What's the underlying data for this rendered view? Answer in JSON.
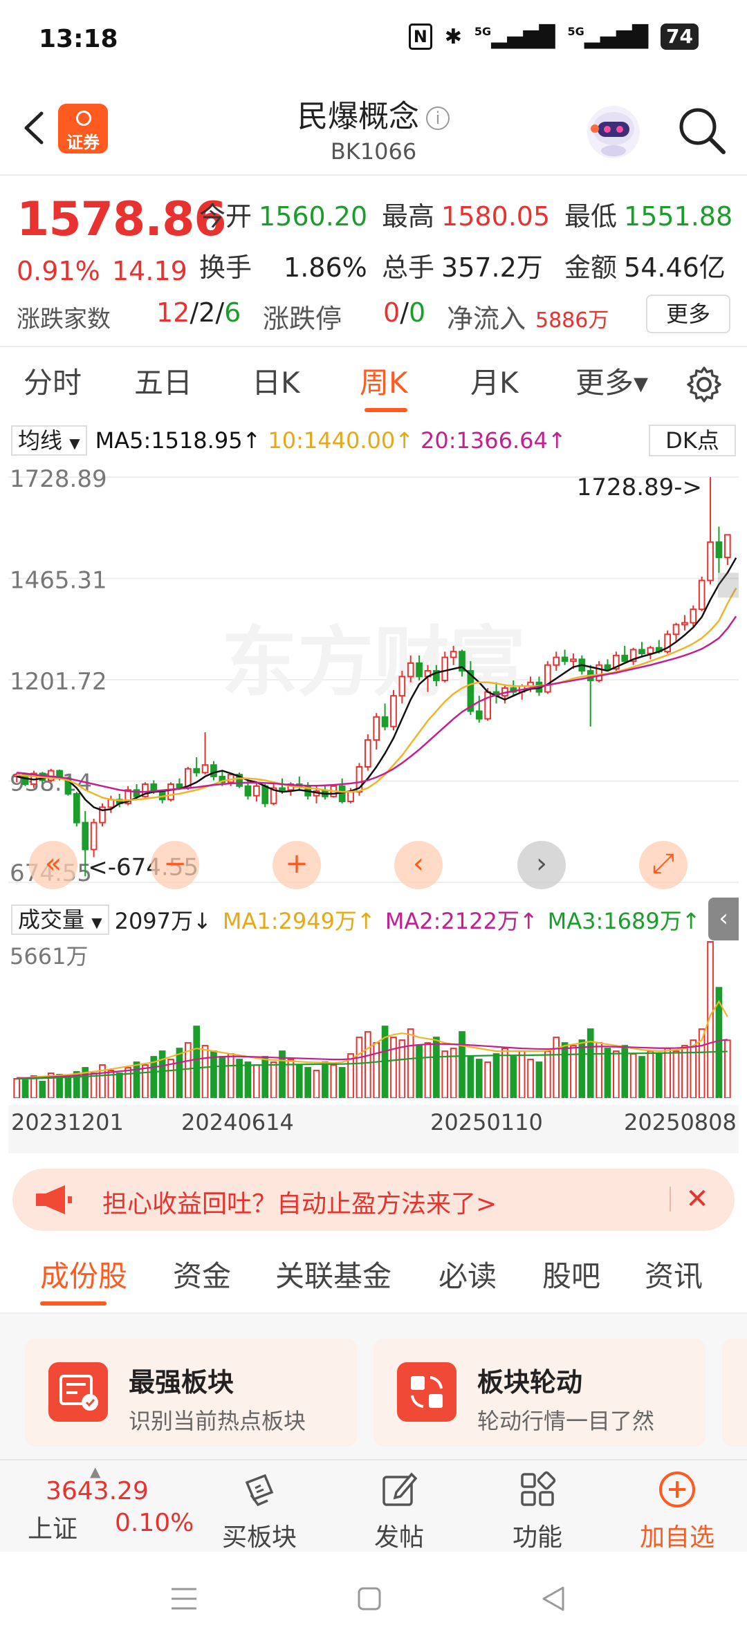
{
  "status_bar": {
    "time": "13:18",
    "signal1": "5G",
    "signal2": "5G",
    "battery": "74"
  },
  "header": {
    "title": "民爆概念",
    "code": "BK1066",
    "broker_logo_text": "证券",
    "info_icon": "i"
  },
  "quote": {
    "price": "1578.86",
    "pct": "0.91%",
    "change": "14.19",
    "open_label": "今开",
    "open": "1560.20",
    "high_label": "最高",
    "high": "1580.05",
    "low_label": "最低",
    "low": "1551.88",
    "turnover_label": "换手",
    "turnover": "1.86%",
    "volume_label": "总手",
    "volume": "357.2万",
    "amount_label": "金额",
    "amount": "54.46亿",
    "breadth_label": "涨跌家数",
    "breadth_up": "12",
    "breadth_flat": "2",
    "breadth_down": "6",
    "sep": "/",
    "limit_label": "涨跌停",
    "limit_up": "0",
    "limit_down": "0",
    "netflow_label": "净流入",
    "netflow": "5886万",
    "more_button": "更多"
  },
  "period_tabs": [
    {
      "label": "分时"
    },
    {
      "label": "五日"
    },
    {
      "label": "日K"
    },
    {
      "label": "周K"
    },
    {
      "label": "月K"
    },
    {
      "label": "更多▾"
    }
  ],
  "active_period": "周K",
  "ma_bar": {
    "select": "均线",
    "ma5": "MA5:1518.95↑",
    "ma10": "10:1440.00↑",
    "ma20": "20:1366.64↑",
    "dk_button": "DK点"
  },
  "colors": {
    "up": "#e8322f",
    "down": "#1a9d2a",
    "ma5": "#111111",
    "ma10": "#f0b429",
    "ma20": "#c41f8f",
    "accent": "#ff5a1f"
  },
  "chart_data": {
    "type": "candlestick",
    "y_ticks": [
      "1728.89",
      "1465.31",
      "1201.72",
      "938.14",
      "674.55"
    ],
    "ylim": [
      674.55,
      1728.89
    ],
    "max_marker": "1728.89->",
    "min_marker": "<-674.55",
    "x_ticks": [
      "20231201",
      "20240614",
      "20250110",
      "20250808"
    ],
    "watermark": "东方财富",
    "candles": [
      [
        950,
        960,
        935,
        955
      ],
      [
        955,
        958,
        925,
        930
      ],
      [
        930,
        965,
        920,
        958
      ],
      [
        958,
        962,
        930,
        940
      ],
      [
        940,
        970,
        935,
        965
      ],
      [
        965,
        968,
        940,
        945
      ],
      [
        945,
        950,
        900,
        905
      ],
      [
        905,
        910,
        820,
        830
      ],
      [
        830,
        860,
        690,
        760
      ],
      [
        760,
        840,
        740,
        830
      ],
      [
        830,
        880,
        820,
        870
      ],
      [
        870,
        900,
        855,
        890
      ],
      [
        890,
        905,
        870,
        880
      ],
      [
        880,
        925,
        875,
        915
      ],
      [
        915,
        930,
        890,
        898
      ],
      [
        898,
        935,
        895,
        930
      ],
      [
        930,
        940,
        905,
        910
      ],
      [
        910,
        915,
        880,
        890
      ],
      [
        890,
        935,
        885,
        930
      ],
      [
        930,
        945,
        915,
        920
      ],
      [
        920,
        975,
        915,
        970
      ],
      [
        970,
        1000,
        950,
        960
      ],
      [
        960,
        1065,
        955,
        980
      ],
      [
        980,
        990,
        940,
        950
      ],
      [
        950,
        965,
        925,
        935
      ],
      [
        935,
        960,
        925,
        955
      ],
      [
        955,
        960,
        920,
        925
      ],
      [
        925,
        940,
        890,
        900
      ],
      [
        900,
        935,
        885,
        925
      ],
      [
        925,
        930,
        870,
        880
      ],
      [
        880,
        930,
        875,
        920
      ],
      [
        920,
        945,
        905,
        915
      ],
      [
        915,
        935,
        900,
        930
      ],
      [
        930,
        950,
        915,
        925
      ],
      [
        925,
        935,
        890,
        900
      ],
      [
        900,
        925,
        880,
        912
      ],
      [
        912,
        928,
        890,
        898
      ],
      [
        898,
        930,
        895,
        925
      ],
      [
        925,
        945,
        880,
        885
      ],
      [
        885,
        920,
        880,
        910
      ],
      [
        910,
        985,
        900,
        975
      ],
      [
        975,
        1060,
        965,
        1045
      ],
      [
        1045,
        1115,
        1020,
        1105
      ],
      [
        1105,
        1140,
        1070,
        1080
      ],
      [
        1080,
        1175,
        1070,
        1160
      ],
      [
        1160,
        1225,
        1140,
        1210
      ],
      [
        1210,
        1265,
        1195,
        1245
      ],
      [
        1245,
        1265,
        1200,
        1210
      ],
      [
        1210,
        1240,
        1170,
        1225
      ],
      [
        1225,
        1240,
        1185,
        1200
      ],
      [
        1200,
        1275,
        1195,
        1260
      ],
      [
        1260,
        1290,
        1240,
        1275
      ],
      [
        1275,
        1280,
        1210,
        1225
      ],
      [
        1225,
        1250,
        1110,
        1120
      ],
      [
        1120,
        1160,
        1090,
        1100
      ],
      [
        1100,
        1180,
        1095,
        1170
      ],
      [
        1170,
        1195,
        1140,
        1160
      ],
      [
        1160,
        1190,
        1140,
        1180
      ],
      [
        1180,
        1200,
        1160,
        1170
      ],
      [
        1170,
        1190,
        1150,
        1185
      ],
      [
        1185,
        1210,
        1170,
        1195
      ],
      [
        1195,
        1210,
        1160,
        1170
      ],
      [
        1170,
        1250,
        1165,
        1240
      ],
      [
        1240,
        1275,
        1225,
        1260
      ],
      [
        1260,
        1280,
        1240,
        1250
      ],
      [
        1250,
        1270,
        1230,
        1255
      ],
      [
        1255,
        1265,
        1215,
        1225
      ],
      [
        1225,
        1240,
        1080,
        1200
      ],
      [
        1200,
        1250,
        1195,
        1240
      ],
      [
        1240,
        1255,
        1225,
        1230
      ],
      [
        1230,
        1275,
        1225,
        1265
      ],
      [
        1265,
        1290,
        1245,
        1250
      ],
      [
        1250,
        1285,
        1240,
        1280
      ],
      [
        1280,
        1300,
        1260,
        1270
      ],
      [
        1270,
        1290,
        1255,
        1285
      ],
      [
        1285,
        1305,
        1270,
        1275
      ],
      [
        1275,
        1330,
        1270,
        1320
      ],
      [
        1320,
        1350,
        1300,
        1345
      ],
      [
        1345,
        1370,
        1330,
        1350
      ],
      [
        1350,
        1395,
        1340,
        1385
      ],
      [
        1385,
        1470,
        1380,
        1460
      ],
      [
        1460,
        1728.89,
        1450,
        1560
      ],
      [
        1560,
        1600,
        1480,
        1520
      ],
      [
        1520,
        1580,
        1500,
        1578.86
      ]
    ],
    "ma5": [
      950,
      945,
      942,
      945,
      950,
      948,
      940,
      920,
      890,
      870,
      862,
      865,
      880,
      885,
      895,
      905,
      910,
      912,
      915,
      918,
      925,
      935,
      950,
      960,
      965,
      958,
      950,
      940,
      935,
      925,
      915,
      910,
      912,
      915,
      912,
      908,
      905,
      905,
      908,
      912,
      920,
      945,
      975,
      1010,
      1050,
      1100,
      1150,
      1190,
      1210,
      1220,
      1225,
      1230,
      1235,
      1215,
      1195,
      1170,
      1160,
      1150,
      1160,
      1170,
      1178,
      1180,
      1190,
      1205,
      1220,
      1235,
      1240,
      1235,
      1230,
      1225,
      1235,
      1245,
      1255,
      1262,
      1268,
      1275,
      1285,
      1300,
      1318,
      1338,
      1365,
      1410,
      1450,
      1480,
      1518.95
    ],
    "ma10": [
      955,
      952,
      950,
      948,
      946,
      945,
      940,
      930,
      915,
      905,
      895,
      890,
      888,
      888,
      890,
      892,
      895,
      898,
      902,
      905,
      910,
      915,
      922,
      930,
      938,
      942,
      945,
      945,
      943,
      940,
      935,
      930,
      925,
      922,
      920,
      918,
      915,
      912,
      910,
      910,
      912,
      920,
      935,
      955,
      980,
      1005,
      1035,
      1065,
      1095,
      1120,
      1145,
      1165,
      1180,
      1190,
      1195,
      1195,
      1192,
      1188,
      1185,
      1185,
      1185,
      1186,
      1188,
      1192,
      1198,
      1205,
      1210,
      1213,
      1215,
      1218,
      1222,
      1228,
      1235,
      1242,
      1250,
      1258,
      1266,
      1275,
      1285,
      1296,
      1310,
      1330,
      1355,
      1400,
      1440
    ],
    "ma20": [
      960,
      958,
      955,
      952,
      950,
      948,
      945,
      940,
      935,
      930,
      925,
      920,
      915,
      912,
      910,
      910,
      912,
      914,
      916,
      918,
      920,
      922,
      925,
      928,
      930,
      932,
      933,
      934,
      934,
      933,
      932,
      930,
      928,
      927,
      926,
      926,
      927,
      928,
      930,
      932,
      935,
      940,
      948,
      958,
      970,
      985,
      1002,
      1020,
      1040,
      1060,
      1080,
      1100,
      1118,
      1132,
      1145,
      1155,
      1162,
      1168,
      1172,
      1176,
      1180,
      1184,
      1188,
      1192,
      1196,
      1200,
      1204,
      1208,
      1212,
      1216,
      1220,
      1225,
      1230,
      1235,
      1240,
      1246,
      1252,
      1258,
      1265,
      1273,
      1282,
      1295,
      1310,
      1335,
      1366.64
    ]
  },
  "volume_bar": {
    "select": "成交量",
    "current": "2097万↓",
    "ma1": "MA1:2949万↑",
    "ma2": "MA2:2122万↑",
    "ma3": "MA3:1689万↑",
    "max_label": "5661万",
    "collapse_icon": "‹"
  },
  "volume_data": {
    "max": 5661,
    "values": [
      700,
      650,
      800,
      600,
      900,
      850,
      750,
      950,
      1100,
      900,
      1200,
      1000,
      900,
      1100,
      1300,
      1200,
      1500,
      1700,
      1400,
      1800,
      2000,
      2600,
      1900,
      1700,
      1500,
      1600,
      1400,
      1300,
      1200,
      1500,
      1300,
      1700,
      1400,
      1200,
      1100,
      1000,
      1300,
      1200,
      1100,
      1600,
      2200,
      2400,
      2000,
      2600,
      2200,
      2100,
      2500,
      1900,
      2000,
      2200,
      1700,
      1800,
      2400,
      1500,
      1400,
      1300,
      1600,
      1800,
      1500,
      1700,
      1400,
      1300,
      1700,
      2200,
      2000,
      1900,
      2100,
      2500,
      2000,
      1800,
      1700,
      1900,
      1600,
      1500,
      1700,
      1600,
      1800,
      1700,
      1900,
      2100,
      2500,
      5661,
      4000,
      2097
    ],
    "ma1": [
      750,
      740,
      760,
      780,
      800,
      820,
      850,
      880,
      920,
      960,
      1000,
      1050,
      1100,
      1150,
      1200,
      1250,
      1300,
      1400,
      1500,
      1600,
      1700,
      1800,
      1750,
      1700,
      1650,
      1600,
      1550,
      1500,
      1450,
      1400,
      1380,
      1360,
      1340,
      1320,
      1300,
      1290,
      1280,
      1270,
      1300,
      1400,
      1600,
      1800,
      2000,
      2200,
      2300,
      2350,
      2300,
      2200,
      2150,
      2100,
      2000,
      1950,
      1900,
      1850,
      1800,
      1750,
      1700,
      1700,
      1700,
      1700,
      1700,
      1700,
      1720,
      1800,
      1900,
      1950,
      2000,
      2050,
      2000,
      1950,
      1900,
      1850,
      1800,
      1750,
      1720,
      1700,
      1720,
      1750,
      1800,
      1900,
      2100,
      3000,
      3500,
      2949
    ],
    "ma2": [
      720,
      720,
      730,
      740,
      760,
      780,
      800,
      820,
      850,
      880,
      910,
      940,
      970,
      1000,
      1040,
      1080,
      1120,
      1170,
      1230,
      1290,
      1350,
      1410,
      1450,
      1480,
      1500,
      1510,
      1510,
      1500,
      1490,
      1480,
      1470,
      1460,
      1450,
      1440,
      1430,
      1420,
      1410,
      1400,
      1400,
      1420,
      1470,
      1540,
      1620,
      1700,
      1780,
      1850,
      1900,
      1930,
      1950,
      1960,
      1960,
      1950,
      1940,
      1920,
      1900,
      1880,
      1860,
      1840,
      1820,
      1800,
      1790,
      1780,
      1780,
      1790,
      1800,
      1820,
      1840,
      1860,
      1870,
      1870,
      1860,
      1850,
      1840,
      1830,
      1820,
      1810,
      1810,
      1815,
      1830,
      1860,
      1900,
      2000,
      2080,
      2122
    ],
    "ma3": [
      700,
      705,
      710,
      720,
      730,
      740,
      750,
      765,
      780,
      800,
      820,
      840,
      860,
      880,
      900,
      925,
      950,
      975,
      1000,
      1030,
      1060,
      1090,
      1115,
      1140,
      1160,
      1175,
      1185,
      1190,
      1195,
      1200,
      1205,
      1210,
      1215,
      1220,
      1225,
      1228,
      1230,
      1232,
      1235,
      1245,
      1260,
      1280,
      1310,
      1340,
      1370,
      1400,
      1430,
      1455,
      1475,
      1490,
      1505,
      1515,
      1525,
      1530,
      1535,
      1540,
      1545,
      1548,
      1550,
      1553,
      1556,
      1560,
      1565,
      1570,
      1578,
      1585,
      1593,
      1600,
      1605,
      1610,
      1613,
      1616,
      1620,
      1624,
      1628,
      1632,
      1636,
      1640,
      1645,
      1650,
      1660,
      1670,
      1680,
      1689
    ]
  },
  "chart_controls": [
    {
      "icon": "«"
    },
    {
      "icon": "−"
    },
    {
      "icon": "+"
    },
    {
      "icon": "‹"
    },
    {
      "icon": "›"
    },
    {
      "icon": "⤢"
    }
  ],
  "promo": {
    "text": "担心收益回吐？自动止盈方法来了>",
    "close_icon": "✕"
  },
  "content_tabs": [
    {
      "label": "成份股"
    },
    {
      "label": "资金"
    },
    {
      "label": "关联基金"
    },
    {
      "label": "必读"
    },
    {
      "label": "股吧"
    },
    {
      "label": "资讯"
    }
  ],
  "cards": [
    {
      "title": "最强板块",
      "subtitle": "识别当前热点板块"
    },
    {
      "title": "板块轮动",
      "subtitle": "轮动行情一目了然"
    }
  ],
  "toolbar": {
    "index_value": "3643.29",
    "index_name": "上证",
    "index_pct": "0.10%",
    "items": [
      {
        "label": "买板块"
      },
      {
        "label": "发帖"
      },
      {
        "label": "功能"
      },
      {
        "label": "加自选"
      }
    ]
  }
}
